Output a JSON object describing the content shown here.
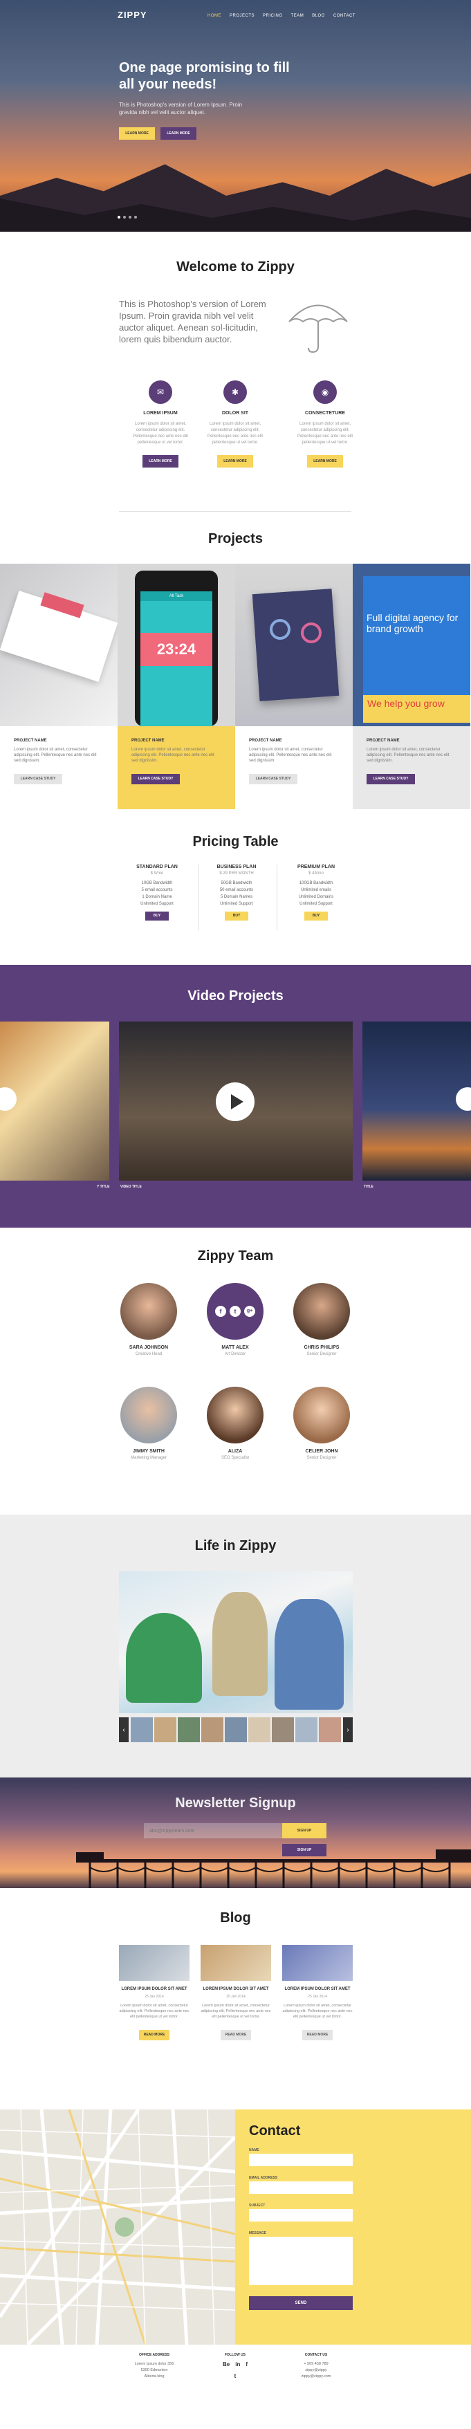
{
  "brand": "ZIPPY",
  "nav": [
    "HOME",
    "PROJECTS",
    "PRICING",
    "TEAM",
    "BLOG",
    "CONTACT"
  ],
  "hero": {
    "title": "One page promising to fill all your needs!",
    "subtitle": "This is Photoshop's version of Lorem Ipsum. Proin gravida nibh vel velit auctor aliquet.",
    "btn_primary": "LEARN MORE",
    "btn_secondary": "LEARN MORE"
  },
  "welcome": {
    "title": "Welcome to Zippy",
    "text": "This is Photoshop's version of Lorem Ipsum. Proin gravida nibh vel velit auctor aliquet. Aenean sol-licitudin, lorem quis bibendum auctor.",
    "features": [
      {
        "title": "LOREM IPSUM",
        "text": "Lorem ipsum dolor sit amet, consectetur adipiscing elit. Pellentesque nec ante nec elit pellentesque ut vel tortor.",
        "button": "LEARN MORE",
        "icon": "envelope-icon"
      },
      {
        "title": "DOLOR SIT",
        "text": "Lorem ipsum dolor sit amet, consectetur adipiscing elit. Pellentesque nec ante nec elit pellentesque ut vel tortor.",
        "button": "LEARN MORE",
        "icon": "lightbulb-icon"
      },
      {
        "title": "CONSECTETURE",
        "text": "Lorem ipsum dolor sit amet, consectetur adipiscing elit. Pellentesque nec ante nec elit pellentesque ut vel tortor.",
        "button": "LEARN MORE",
        "icon": "camera-icon"
      }
    ]
  },
  "projects": {
    "title": "Projects",
    "items": [
      {
        "name": "PROJECT NAME",
        "text": "Lorem ipsum dolor sit amet, consectetur adipiscing elit. Pellentesque nec ante nec elit sed dignissim.",
        "button": "LEARN CASE STUDY"
      },
      {
        "name": "PROJECT NAME",
        "text": "Lorem ipsum dolor sit amet, consectetur adipiscing elit. Pellentesque nec ante nec elit sed dignissim.",
        "button": "LEARN CASE STUDY"
      },
      {
        "name": "PROJECT NAME",
        "text": "Lorem ipsum dolor sit amet, consectetur adipiscing elit. Pellentesque nec ante nec elit sed dignissim.",
        "button": "LEARN CASE STUDY"
      },
      {
        "name": "PROJECT NAME",
        "text": "Lorem ipsum dolor sit amet, consectetur adipiscing elit. Pellentesque nec ante nec elit sed dignissim.",
        "button": "LEARN CASE STUDY"
      }
    ],
    "phone_time": "23:24",
    "phone_header": "All Task",
    "tablet_title": "Full digital agency for brand growth",
    "tablet_sub": "We help you grow"
  },
  "pricing": {
    "title": "Pricing Table",
    "plans": [
      {
        "name": "STANDARD PLAN",
        "price": "$ 9/mo",
        "features": [
          "10GB Bandwidth",
          "5 email accounts",
          "1 Domain Name",
          "Unlimited Support"
        ],
        "button": "BUY"
      },
      {
        "name": "BUSINESS PLAN",
        "price": "$ 29 PER MONTH",
        "features": [
          "50GB Bandwidth",
          "50 email accounts",
          "5 Domain Names",
          "Unlimited Support"
        ],
        "button": "BUY"
      },
      {
        "name": "PREMIUM PLAN",
        "price": "$ 49/mo",
        "features": [
          "100GB Bandwidth",
          "Unlimited emails",
          "Unlimited Domains",
          "Unlimited Support"
        ],
        "button": "BUY"
      }
    ]
  },
  "video": {
    "title": "Video Projects",
    "labels": [
      "Y TITLE",
      "VIDEO TITLE",
      "TITLE"
    ]
  },
  "team": {
    "title": "Zippy Team",
    "members": [
      {
        "name": "SARA JOHNSON",
        "role": "Creative Head"
      },
      {
        "name": "MATT ALEX",
        "role": "Art Director"
      },
      {
        "name": "CHRIS PHILIPS",
        "role": "Senior Designer"
      },
      {
        "name": "JIMMY SMITH",
        "role": "Marketing Manager"
      },
      {
        "name": "ALIZA",
        "role": "SEO Specialist"
      },
      {
        "name": "CELIER JOHN",
        "role": "Senior Designer"
      }
    ],
    "socials": [
      "f",
      "t",
      "g+"
    ]
  },
  "life": {
    "title": "Life in Zippy",
    "prev": "‹",
    "next": "›"
  },
  "newsletter": {
    "title": "Newsletter Signup",
    "placeholder": "abc@zippyteam.com",
    "button": "SIGN UP",
    "button2": "SIGN UP"
  },
  "blog": {
    "title": "Blog",
    "posts": [
      {
        "title": "LOREM IPSUM DOLOR SIT AMET",
        "date": "25 Jan 2014",
        "text": "Lorem ipsum dolor sit amet, consectetur adipiscing elit. Pellentesque nec ante nec elit pellentesque ut vel tortor.",
        "button": "READ MORE"
      },
      {
        "title": "LOREM IPSUM DOLOR SIT AMET",
        "date": "25 Jan 2014",
        "text": "Lorem ipsum dolor sit amet, consectetur adipiscing elit. Pellentesque nec ante nec elit pellentesque ut vel tortor.",
        "button": "READ MORE"
      },
      {
        "title": "LOREM IPSUM DOLOR SIT AMET",
        "date": "25 Jan 2014",
        "text": "Lorem ipsum dolor sit amet, consectetur adipiscing elit. Pellentesque nec ante nec elit pellentesque ut vel tortor.",
        "button": "READ MORE"
      }
    ]
  },
  "contact": {
    "title": "Contact",
    "name_label": "NAME",
    "email_label": "EMAIL ADDRESS",
    "subject_label": "SUBJECT",
    "message_label": "MESSAGE",
    "send": "SEND"
  },
  "footer": {
    "office_title": "OFFICE ADDRESS",
    "office_lines": [
      "Lorem Ipsum dolor 356",
      "5300 Edmonton",
      "Alberta king"
    ],
    "follow_title": "FOLLOW US",
    "follow": [
      "Be",
      "in",
      "f",
      "t"
    ],
    "contact_title": "CONTACT US",
    "contact_lines": [
      "+ 509 458 789",
      "zippy@zippy",
      "zippy@zippy.com"
    ]
  },
  "colors": {
    "purple": "#5b3d78",
    "yellow": "#f7d45a",
    "contact_yellow": "#fbdf6d"
  }
}
